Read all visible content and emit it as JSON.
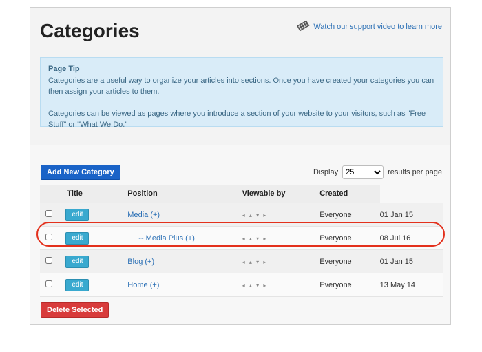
{
  "header": {
    "title": "Categories",
    "support_link": "Watch our support video to learn more",
    "support_icon": "film-reel-icon"
  },
  "tip": {
    "title": "Page Tip",
    "paragraph1": "Categories are a useful way to organize your articles into sections. Once you have created your categories you can then assign your articles to them.",
    "paragraph2": "Categories can be viewed as pages where you introduce a section of your website to your visitors, such as \"Free Stuff\" or \"What We Do.\""
  },
  "toolbar": {
    "add_label": "Add New Category",
    "display_label": "Display",
    "display_value": "25",
    "display_suffix": "results per page"
  },
  "table": {
    "columns": [
      "Title",
      "Position",
      "Viewable by",
      "Created"
    ],
    "edit_label": "edit",
    "position_arrows": "◂ ▴ ▾ ▸",
    "rows": [
      {
        "title": "Media (+)",
        "viewable": "Everyone",
        "created": "01 Jan 15",
        "child": false
      },
      {
        "title": "-- Media Plus (+)",
        "viewable": "Everyone",
        "created": "08 Jul 16",
        "child": true
      },
      {
        "title": "Blog (+)",
        "viewable": "Everyone",
        "created": "01 Jan 15",
        "child": false
      },
      {
        "title": "Home (+)",
        "viewable": "Everyone",
        "created": "13 May 14",
        "child": false
      }
    ]
  },
  "footer": {
    "delete_label": "Delete Selected"
  },
  "colors": {
    "primary_button": "#1a63c7",
    "edit_button": "#39a9cf",
    "delete_button": "#d83b3b",
    "link": "#2a6fb5",
    "tip_background": "#d9ecf8",
    "highlight": "#e3301c"
  }
}
